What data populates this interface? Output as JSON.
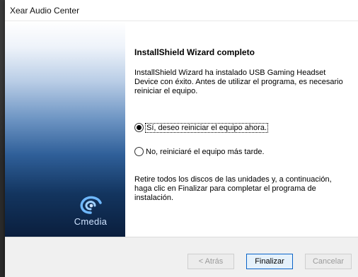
{
  "window": {
    "title": "Xear Audio Center"
  },
  "sidebar": {
    "logo_text": "Cmedia"
  },
  "content": {
    "heading": "InstallShield Wizard completo",
    "description": "InstallShield Wizard ha instalado  USB Gaming Headset Device con éxito. Antes de utilizar el programa, es necesario reiniciar el equipo.",
    "options": [
      {
        "label": "Sí, deseo reiniciar el equipo ahora.",
        "selected": true
      },
      {
        "label": "No, reiniciaré el equipo más tarde.",
        "selected": false
      }
    ],
    "note": "Retire todos los discos de las unidades y, a continuación, haga clic en Finalizar para completar el programa de instalación."
  },
  "footer": {
    "back_label": "< Atrás",
    "finish_label": "Finalizar",
    "cancel_label": "Cancelar"
  },
  "colors": {
    "accent": "#0a64c8",
    "sidebar_dark": "#0a1e3d"
  }
}
